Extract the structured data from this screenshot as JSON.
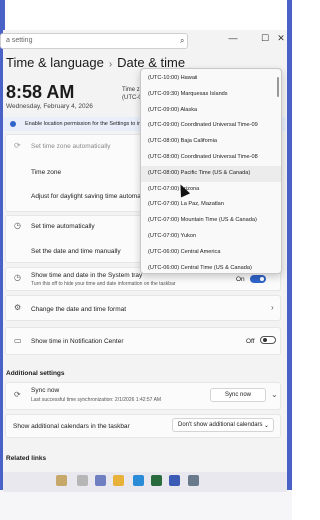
{
  "search": {
    "placeholder": "a setting"
  },
  "window": {
    "min": "—",
    "max": "☐",
    "close": "✕"
  },
  "header": {
    "section": "Time & language",
    "page": "Date & time"
  },
  "clock": {
    "time": "8:58 AM",
    "date": "Wednesday, February 4, 2026",
    "tz_peek": "Time z",
    "tz_peek2": "(UTC-08:"
  },
  "info": {
    "text": "Enable location permission for the Settings to improve"
  },
  "rows": {
    "set_tz_auto": "Set time zone automatically",
    "time_zone": "Time zone",
    "dst": "Adjust for daylight saving time automatica",
    "set_time_auto": "Set time automatically",
    "set_manually": "Set the date and time manually",
    "show_tray": "Show time and date in the System tray",
    "show_tray_sub": "Turn this off to hide your time and date information on the taskbar",
    "show_tray_state": "On",
    "change_format": "Change the date and time format",
    "notif_center": "Show time in Notification Center",
    "notif_state": "Off"
  },
  "additional": {
    "heading": "Additional settings",
    "sync_title": "Sync now",
    "sync_sub": "Last successful time synchronization: 2/1/2026 1:42:57 AM",
    "sync_button": "Sync now",
    "calendars_label": "Show additional calendars in the taskbar",
    "calendars_value": "Don't show additional calendars"
  },
  "related": {
    "heading": "Related links"
  },
  "dropdown": {
    "items": [
      "(UTC-10:00) Hawaii",
      "(UTC-09:30) Marquesas Islands",
      "(UTC-09:00) Alaska",
      "(UTC-09:00) Coordinated Universal Time-09",
      "(UTC-08:00) Baja California",
      "(UTC-08:00) Coordinated Universal Time-08",
      "(UTC-08:00) Pacific Time (US & Canada)",
      "(UTC-07:00) Arizona",
      "(UTC-07:00) La Paz, Mazatlan",
      "(UTC-07:00) Mountain Time (US & Canada)",
      "(UTC-07:00) Yukon",
      "(UTC-06:00) Central America",
      "(UTC-06:00) Central Time (US & Canada)"
    ],
    "selected": "(UTC-08:00) Pacific Time (US & Canada)"
  },
  "colors": {
    "accent": "#2f64c9",
    "frame": "#4a62c8"
  }
}
